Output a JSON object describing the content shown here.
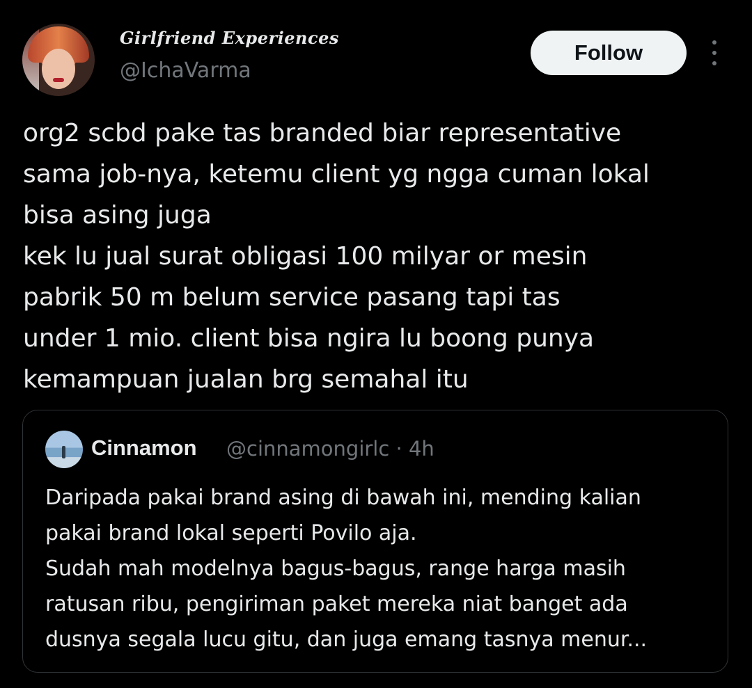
{
  "author": {
    "display_name": "Girlfriend Experiences",
    "handle": "@IchaVarma",
    "avatar_icon": "profile-photo"
  },
  "actions": {
    "follow_label": "Follow",
    "more_icon": "more-vertical-icon"
  },
  "tweet": {
    "text": "org2 scbd pake tas branded biar representative\nsama job-nya, ketemu client yg ngga cuman lokal\nbisa asing juga\nkek lu jual surat obligasi 100 milyar or mesin\npabrik 50 m belum service pasang tapi tas\nunder 1 mio. client bisa ngira lu boong punya\nkemampuan jualan brg semahal itu"
  },
  "quote": {
    "display_name": "Cinnamon",
    "handle_time": "@cinnamongirlc · 4h",
    "text": "Daripada pakai brand asing di bawah ini, mending kalian\npakai brand lokal seperti Povilo aja.\nSudah mah modelnya bagus-bagus, range harga masih\nratusan ribu, pengiriman paket mereka niat banget ada\ndusnya segala lucu gitu, dan juga emang tasnya menur..."
  },
  "colors": {
    "background": "#000000",
    "text": "#e7e9ea",
    "secondary_text": "#71767b",
    "border": "#2f3336",
    "button_bg": "#eff3f4"
  }
}
